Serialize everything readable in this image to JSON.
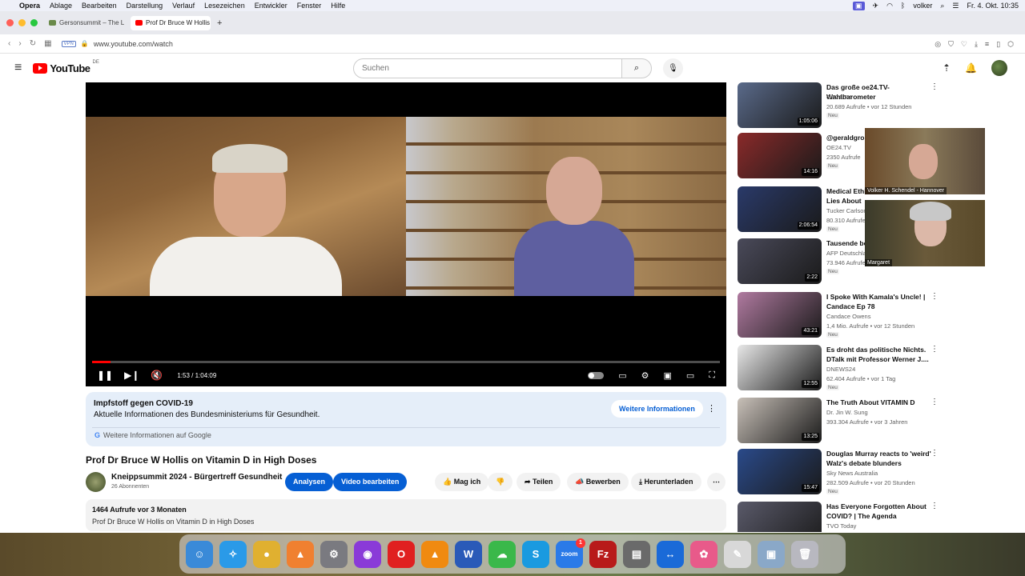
{
  "menubar": {
    "apple": "",
    "items": [
      "Opera",
      "Ablage",
      "Bearbeiten",
      "Darstellung",
      "Verlauf",
      "Lesezeichen",
      "Entwickler",
      "Fenster",
      "Hilfe"
    ],
    "user": "volker",
    "clock": "Fr. 4. Okt.  10:35"
  },
  "tabs": [
    {
      "label": "Gersonsummit – The Le"
    },
    {
      "label": "Prof Dr Bruce W Hollis o"
    }
  ],
  "address": {
    "url": "www.youtube.com/watch",
    "vpn": "VPN"
  },
  "youtube": {
    "logo": "YouTube",
    "country": "DE",
    "search_placeholder": "Suchen"
  },
  "player": {
    "time": "1:53 / 1:04:09",
    "progress": 0.029
  },
  "info_panel": {
    "title": "Impfstoff gegen COVID-19",
    "subtitle": "Aktuelle Informationen des Bundesministeriums für Gesundheit.",
    "button": "Weitere Informationen",
    "google": "Weitere Informationen auf Google"
  },
  "video": {
    "title": "Prof Dr Bruce W Hollis on Vitamin D in High Doses",
    "channel": "Kneippsummit 2024 - Bürgertreff Gesundheit",
    "subs": "26 Abonnenten",
    "btn_analytics": "Analysen",
    "btn_edit": "Video bearbeiten",
    "like": "Mag ich",
    "share": "Teilen",
    "promote": "Bewerben",
    "download": "Herunterladen",
    "views_age": "1464 Aufrufe  vor 3 Monaten",
    "description": "Prof  Dr  Bruce  W  Hollis on Vitamin D in High Doses"
  },
  "sidebar": [
    {
      "title": "Das große oe24.TV-Wahlbarometer",
      "channel": "OE24.TV",
      "meta": "20.689 Aufrufe • vor 12 Stunden",
      "new": "Neu",
      "duration": "1:05:06",
      "color": "#5a6a8a"
    },
    {
      "title": "@geraldgrosz Demos: Anti",
      "channel": "OE24.TV",
      "meta": "2350 Aufrufe",
      "new": "Neu",
      "duration": "14:16",
      "color": "#8a2a2a"
    },
    {
      "title": "Medical Ethics Debunks Media Lies About",
      "channel": "Tucker Carlson",
      "meta": "80.310 Aufrufe",
      "new": "Neu",
      "duration": "2:06:54",
      "color": "#2a3a6a"
    },
    {
      "title": "Tausende bei Demo für Frieden",
      "channel": "AFP Deutschland",
      "meta": "73.946 Aufrufe • vor 17 Stunden",
      "new": "Neu",
      "duration": "2:22",
      "color": "#4a4a5a"
    },
    {
      "title": "I Spoke With Kamala's Uncle! | Candace Ep 78",
      "channel": "Candace Owens",
      "meta": "1,4 Mio. Aufrufe • vor 12 Stunden",
      "new": "Neu",
      "duration": "43:21",
      "color": "#b07aa0"
    },
    {
      "title": "Es droht das politische Nichts. DTalk mit Professor Werner J....",
      "channel": "DNEWS24",
      "meta": "62.404 Aufrufe • vor 1 Tag",
      "new": "Neu",
      "duration": "12:55",
      "color": "#e8e8e8"
    },
    {
      "title": "The Truth About VITAMIN D",
      "channel": "Dr. Jin W. Sung",
      "meta": "393.304 Aufrufe • vor 3 Jahren",
      "new": "",
      "duration": "13:25",
      "color": "#c8c0b8"
    },
    {
      "title": "Douglas Murray reacts to 'weird' Walz's debate blunders",
      "channel": "Sky News Australia",
      "meta": "282.509 Aufrufe • vor 20 Stunden",
      "new": "Neu",
      "duration": "15:47",
      "color": "#2a4a8a"
    },
    {
      "title": "Has Everyone Forgotten About COVID? | The Agenda",
      "channel": "TVO Today",
      "meta": "",
      "new": "",
      "duration": "",
      "color": "#5a5a6a"
    }
  ],
  "overlays": [
    {
      "label": "Volker H. Schendel - Hannover"
    },
    {
      "label": "Margaret"
    }
  ],
  "dock": [
    {
      "name": "finder-icon",
      "color": "#3a8ad8",
      "glyph": "☺"
    },
    {
      "name": "safari-icon",
      "color": "#2a9ae8",
      "glyph": "✧"
    },
    {
      "name": "chrome-icon",
      "color": "#e0b030",
      "glyph": "●"
    },
    {
      "name": "affinity-icon",
      "color": "#f08030",
      "glyph": "▲"
    },
    {
      "name": "system-settings-icon",
      "color": "#7a7a80",
      "glyph": "⚙"
    },
    {
      "name": "firefox-icon",
      "color": "#8a3ad8",
      "glyph": "◉"
    },
    {
      "name": "opera-icon",
      "color": "#e02020",
      "glyph": "O"
    },
    {
      "name": "vlc-icon",
      "color": "#f08a10",
      "glyph": "▲"
    },
    {
      "name": "word-icon",
      "color": "#2a5ab8",
      "glyph": "W"
    },
    {
      "name": "cloud-icon",
      "color": "#3ab84a",
      "glyph": "☁"
    },
    {
      "name": "skype-icon",
      "color": "#1a9ae0",
      "glyph": "S"
    },
    {
      "name": "zoom-icon",
      "color": "#2a7ae8",
      "glyph": "zoom",
      "badge": "1"
    },
    {
      "name": "filezilla-icon",
      "color": "#b81a1a",
      "glyph": "Fz"
    },
    {
      "name": "printer-icon",
      "color": "#6a6a6a",
      "glyph": "▤"
    },
    {
      "name": "teamviewer-icon",
      "color": "#1a6ad8",
      "glyph": "↔"
    },
    {
      "name": "photos-icon",
      "color": "#e85a8a",
      "glyph": "✿"
    },
    {
      "name": "textedit-icon",
      "color": "#d8d8d8",
      "glyph": "✎"
    },
    {
      "name": "preview-icon",
      "color": "#8aa8c8",
      "glyph": "▣"
    },
    {
      "name": "trash-icon",
      "color": "#b8b8c0",
      "glyph": "🗑"
    }
  ]
}
